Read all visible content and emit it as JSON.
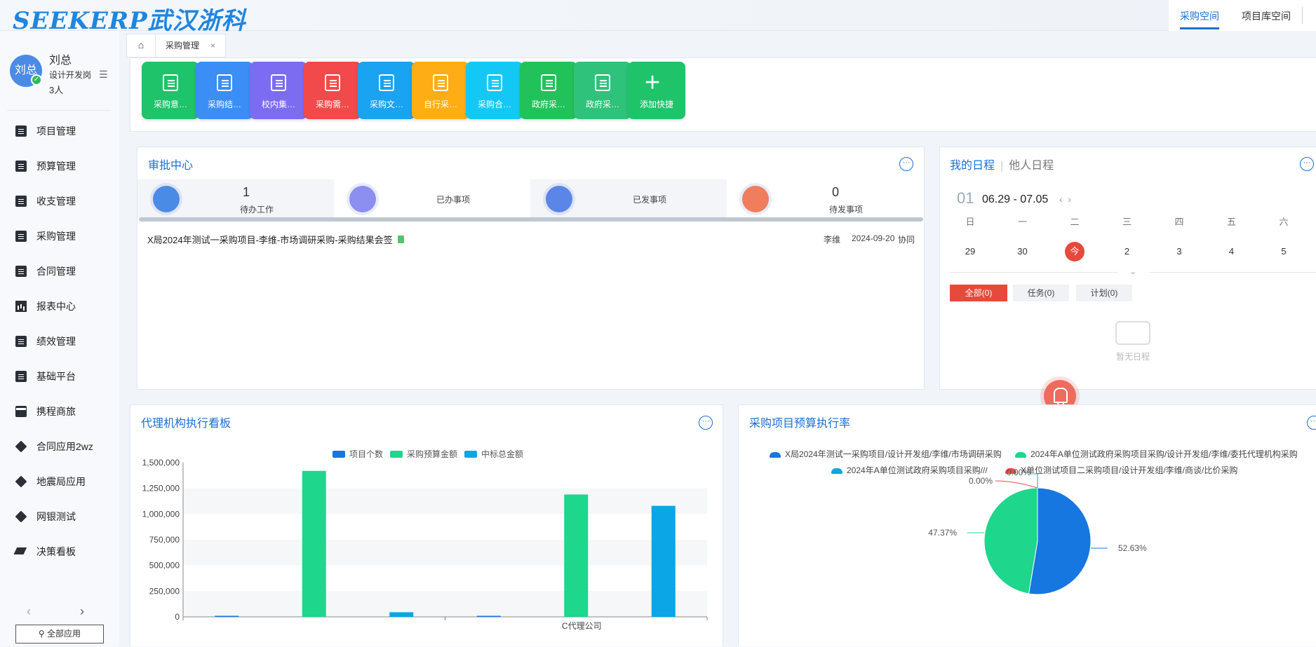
{
  "brand": {
    "logo": "SEEKERP武汉浙科"
  },
  "top_tabs": [
    "采购空间",
    "项目库空间"
  ],
  "user": {
    "avatar_text": "刘总",
    "name": "刘总",
    "role": "设计开发岗",
    "count": "3人"
  },
  "menu": [
    {
      "label": "项目管理",
      "icon": "document-icon"
    },
    {
      "label": "预算管理",
      "icon": "document-icon"
    },
    {
      "label": "收支管理",
      "icon": "document-icon"
    },
    {
      "label": "采购管理",
      "icon": "document-icon"
    },
    {
      "label": "合同管理",
      "icon": "document-icon"
    },
    {
      "label": "报表中心",
      "icon": "chart-icon"
    },
    {
      "label": "绩效管理",
      "icon": "document-icon"
    },
    {
      "label": "基础平台",
      "icon": "document-icon"
    },
    {
      "label": "携程商旅",
      "icon": "card-icon"
    },
    {
      "label": "合同应用2wz",
      "icon": "cube-icon"
    },
    {
      "label": "地震局应用",
      "icon": "cube-icon"
    },
    {
      "label": "网银测试",
      "icon": "cube-icon"
    },
    {
      "label": "决策看板",
      "icon": "layers-icon"
    }
  ],
  "all_apps": "全部应用",
  "tabs": {
    "current": "采购管理",
    "close": "×"
  },
  "quick": [
    {
      "label": "采购意…",
      "color": "#1fc36a"
    },
    {
      "label": "采购结…",
      "color": "#3a8ef5"
    },
    {
      "label": "校内集…",
      "color": "#7c6cf2"
    },
    {
      "label": "采购需…",
      "color": "#f2494a"
    },
    {
      "label": "采购文…",
      "color": "#1aa3f0"
    },
    {
      "label": "自行采…",
      "color": "#ffad14"
    },
    {
      "label": "采购合…",
      "color": "#14c8f5"
    },
    {
      "label": "政府采…",
      "color": "#22c25a"
    },
    {
      "label": "政府采…",
      "color": "#2ec27a"
    },
    {
      "label": "添加快捷",
      "color": "#1fc36a"
    }
  ],
  "approval": {
    "title": "审批中心",
    "stats": [
      {
        "num": "1",
        "label": "待办工作",
        "color": "#4a8be6"
      },
      {
        "num": "",
        "label": "已办事项",
        "color": "#8c8ff0"
      },
      {
        "num": "",
        "label": "已发事项",
        "color": "#5b86e8"
      },
      {
        "num": "0",
        "label": "待发事项",
        "color": "#f07d5c"
      }
    ],
    "items": [
      {
        "title": "X局2024年测试一采购项目-李维-市场调研采购-采购结果会签",
        "person": "李维",
        "date": "2024-09-20",
        "type": "协同"
      }
    ]
  },
  "schedule": {
    "tab_mine": "我的日程",
    "tab_others": "他人日程",
    "week_no": "01",
    "range": "06.29 - 07.05",
    "weekdays": [
      "日",
      "一",
      "二",
      "三",
      "四",
      "五",
      "六"
    ],
    "days": [
      "29",
      "30",
      "今",
      "2",
      "3",
      "4",
      "5"
    ],
    "filters": [
      "全部(0)",
      "任务(0)",
      "计划(0)"
    ],
    "empty": "暂无日程"
  },
  "agency": {
    "title": "代理机构执行看板",
    "legend": [
      "项目个数",
      "采购预算金额",
      "中标总金额"
    ]
  },
  "budget": {
    "title": "采购项目预算执行率"
  },
  "chart_data": [
    {
      "type": "bar",
      "categories": [
        "",
        "C代理公司"
      ],
      "series": [
        {
          "name": "项目个数",
          "color": "#1677e0",
          "values": [
            1,
            1
          ]
        },
        {
          "name": "采购预算金额",
          "color": "#1ed68c",
          "values": [
            1420000,
            1190000
          ]
        },
        {
          "name": "中标总金额",
          "color": "#0aa6e6",
          "values": [
            45000,
            1080000
          ]
        }
      ],
      "yticks": [
        "0",
        "250,000",
        "500,000",
        "750,000",
        "1,000,000",
        "1,250,000",
        "1,500,000"
      ],
      "ylim": [
        0,
        1500000
      ],
      "legend": "top"
    },
    {
      "type": "pie",
      "labels": [
        "X局2024年测试一采购项目/设计开发组/李维/市场调研采购",
        "2024年A单位测试政府采购项目采购/设计开发组/李维/委托代理机构采购",
        "2024年A单位测试政府采购项目采购///",
        "X单位测试项目二采购项目/设计开发组/李维/商谈/比价采购"
      ],
      "values": [
        52.63,
        47.37,
        0.0,
        0.0
      ],
      "value_labels": [
        "52.63%",
        "47.37%",
        "0.00%",
        "0.00%"
      ],
      "colors": [
        "#1677e0",
        "#1ed68c",
        "#0aa6e6",
        "#f2494a"
      ],
      "legend": "top"
    }
  ]
}
